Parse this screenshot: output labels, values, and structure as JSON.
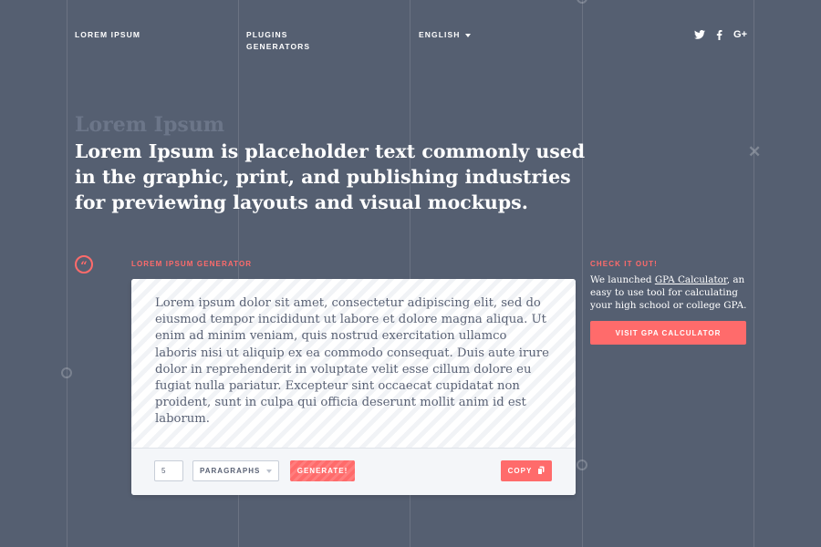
{
  "nav": {
    "brand": "LOREM IPSUM",
    "links": [
      "PLUGINS",
      "GENERATORS"
    ],
    "language": "ENGLISH",
    "social": [
      {
        "name": "twitter-icon"
      },
      {
        "name": "facebook-icon"
      },
      {
        "name": "google-plus-icon",
        "label": "G+"
      }
    ]
  },
  "hero": {
    "ghost_title": "Lorem Ipsum",
    "title": "Lorem Ipsum is placeholder text commonly used in the graphic, print, and publishing industries for previewing layouts and visual mockups."
  },
  "generator": {
    "section_label": "LOREM IPSUM GENERATOR",
    "quote_mark": "“",
    "text": "Lorem ipsum dolor sit amet, consectetur adipiscing elit, sed do eiusmod tempor incididunt ut labore et dolore magna aliqua. Ut enim ad minim veniam, quis nostrud exercitation ullamco laboris nisi ut aliquip ex ea commodo consequat. Duis aute irure dolor in reprehenderit in voluptate velit esse cillum dolore eu fugiat nulla pariatur. Excepteur sint occaecat cupidatat non proident, sunt in culpa qui officia deserunt mollit anim id est laborum.",
    "count_value": "5",
    "unit_label": "PARAGRAPHS",
    "generate_label": "GENERATE!",
    "copy_label": "COPY"
  },
  "promo": {
    "label": "CHECK IT OUT!",
    "text_before": "We launched ",
    "link_text": "GPA Calculator",
    "text_after": ", an easy to use tool for calculating your high school or college GPA.",
    "button_label": "VISIT GPA CALCULATOR"
  },
  "colors": {
    "background": "#555f71",
    "accent": "#ff6b6b",
    "card": "#ffffff",
    "body_text": "#5a6275"
  }
}
